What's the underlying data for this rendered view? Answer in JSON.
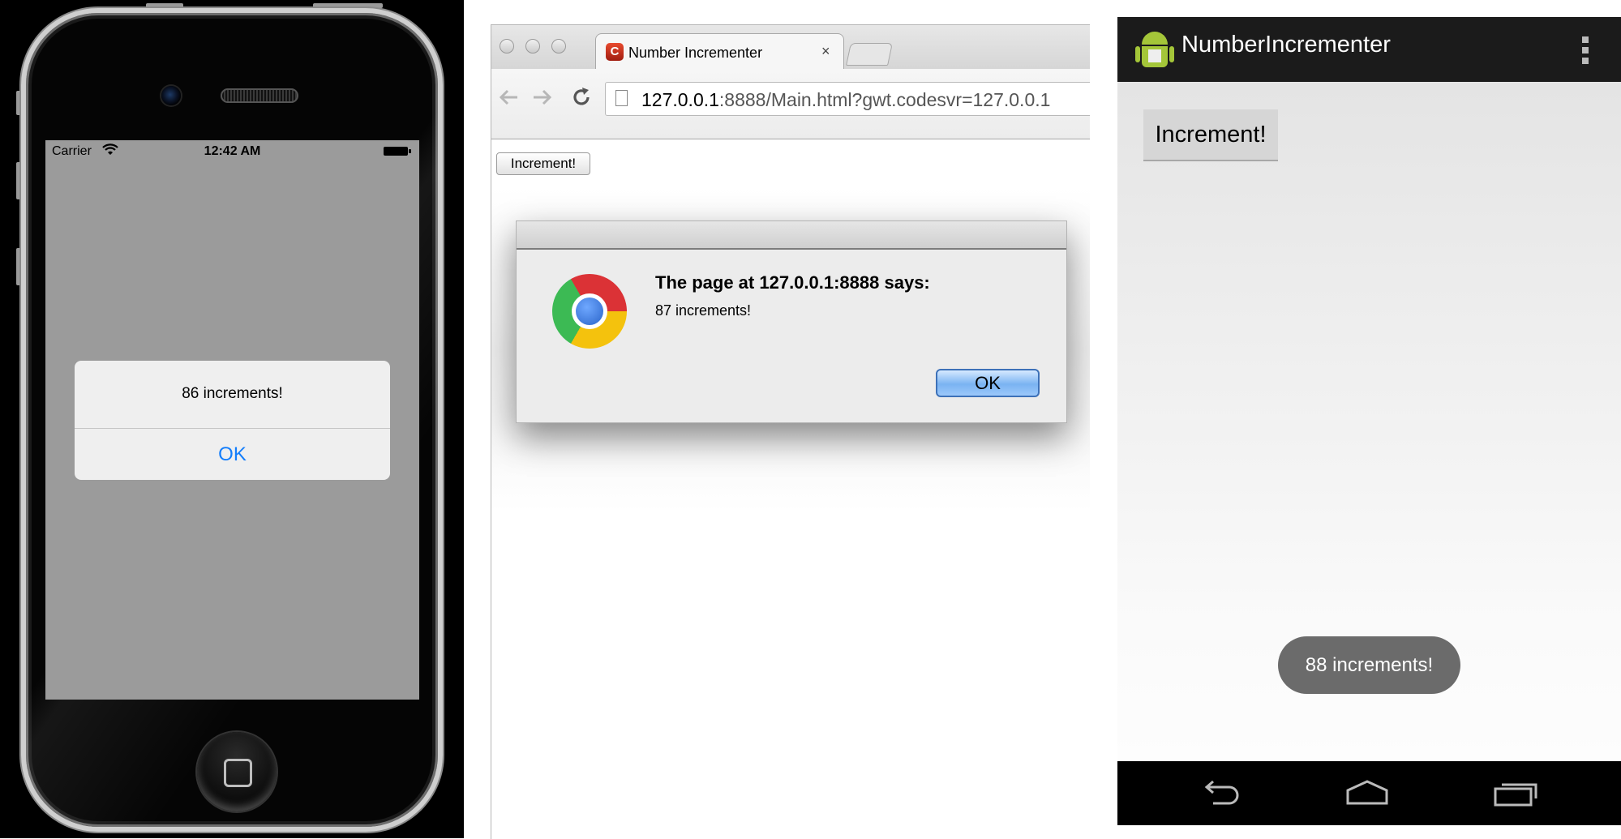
{
  "ios": {
    "status_carrier": "Carrier",
    "status_time": "12:42 AM",
    "alert_message": "86 increments!",
    "alert_ok": "OK"
  },
  "chrome": {
    "tab_title": "Number Incrementer",
    "tab_favicon_letter": "C",
    "tab_close": "×",
    "url_host": "127.0.0.1",
    "url_rest": ":8888/Main.html?gwt.codesvr=127.0.0.1",
    "page_button": "Increment!",
    "dialog_heading": "The page at 127.0.0.1:8888 says:",
    "dialog_message": "87 increments!",
    "dialog_ok": "OK",
    "icons": {
      "back": "arrow-left-icon",
      "forward": "arrow-right-icon",
      "reload": "reload-icon"
    }
  },
  "android": {
    "app_title": "NumberIncrementer",
    "button_label": "Increment!",
    "toast_message": "88 increments!",
    "action_bar_color": "#1b1b1b",
    "toast_color": "#6b6b6b"
  }
}
